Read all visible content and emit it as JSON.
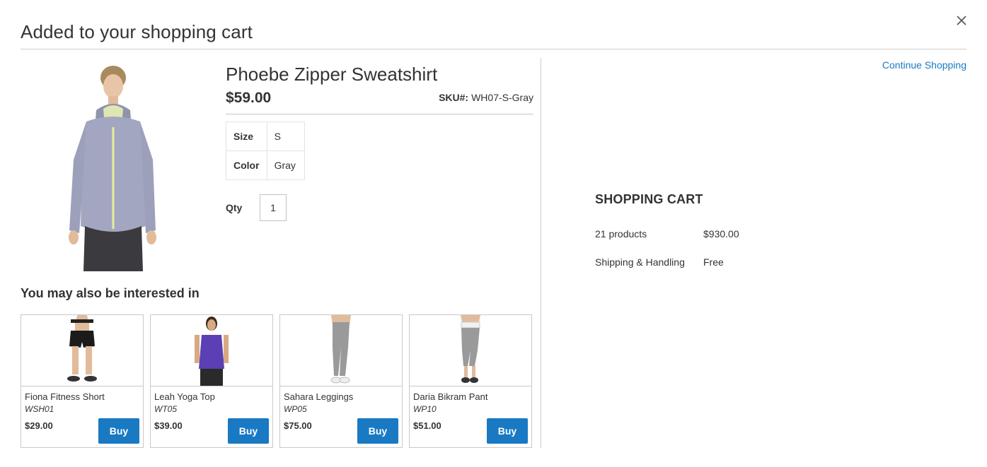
{
  "modal": {
    "title": "Added to your shopping cart"
  },
  "product": {
    "name": "Phoebe Zipper Sweatshirt",
    "price": "$59.00",
    "sku_label": "SKU#:",
    "sku_value": "WH07-S-Gray",
    "options": [
      {
        "label": "Size",
        "value": "S"
      },
      {
        "label": "Color",
        "value": "Gray"
      }
    ],
    "qty_label": "Qty",
    "qty_value": "1"
  },
  "related": {
    "title": "You may also be interested in",
    "items": [
      {
        "name": "Fiona Fitness Short",
        "sku": "WSH01",
        "price": "$29.00",
        "buy_label": "Buy"
      },
      {
        "name": "Leah Yoga Top",
        "sku": "WT05",
        "price": "$39.00",
        "buy_label": "Buy"
      },
      {
        "name": "Sahara Leggings",
        "sku": "WP05",
        "price": "$75.00",
        "buy_label": "Buy"
      },
      {
        "name": "Daria Bikram Pant",
        "sku": "WP10",
        "price": "$51.00",
        "buy_label": "Buy"
      }
    ]
  },
  "sidebar": {
    "continue_label": "Continue Shopping",
    "cart_title": "SHOPPING CART",
    "rows": [
      {
        "label": "21 products",
        "value": "$930.00"
      },
      {
        "label": "Shipping & Handling",
        "value": "Free"
      }
    ]
  },
  "colors": {
    "accent": "#1979c3",
    "text": "#333333",
    "border": "#c9c9c9"
  }
}
